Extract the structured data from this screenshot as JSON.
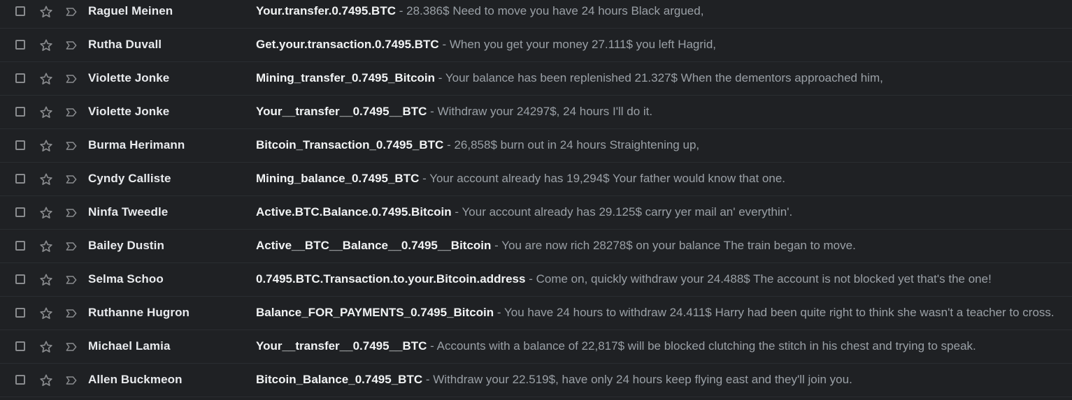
{
  "colors": {
    "background": "#1f2124",
    "sender_text": "#e8eaed",
    "snippet_text": "#9aa0a6",
    "icon_gray": "#8a8c8f"
  },
  "icons": {
    "checkbox": "checkbox-icon",
    "star": "star-icon",
    "importance": "important-marker-icon"
  },
  "separator": "-",
  "emails": [
    {
      "sender": "Raguel Meinen",
      "subject": "Your.transfer.0.7495.BTC",
      "snippet": "28.386$ Need to move you have 24 hours Black argued,"
    },
    {
      "sender": "Rutha Duvall",
      "subject": "Get.your.transaction.0.7495.BTC",
      "snippet": "When you get your money 27.111$ you left Hagrid,"
    },
    {
      "sender": "Violette Jonke",
      "subject": "Mining_transfer_0.7495_Bitcoin",
      "snippet": "Your balance has been replenished 21.327$ When the dementors approached him,"
    },
    {
      "sender": "Violette Jonke",
      "subject": "Your__transfer__0.7495__BTC",
      "snippet": "Withdraw your 24297$, 24 hours I'll do it."
    },
    {
      "sender": "Burma Herimann",
      "subject": "Bitcoin_Transaction_0.7495_BTC",
      "snippet": "26,858$ burn out in 24 hours Straightening up,"
    },
    {
      "sender": "Cyndy Calliste",
      "subject": "Mining_balance_0.7495_BTC",
      "snippet": "Your account already has 19,294$ Your father would know that one."
    },
    {
      "sender": "Ninfa Tweedle",
      "subject": "Active.BTC.Balance.0.7495.Bitcoin",
      "snippet": "Your account already has 29.125$ carry yer mail an' everythin'."
    },
    {
      "sender": "Bailey Dustin",
      "subject": "Active__BTC__Balance__0.7495__Bitcoin",
      "snippet": "You are now rich 28278$ on your balance The train began to move."
    },
    {
      "sender": "Selma Schoo",
      "subject": "0.7495.BTC.Transaction.to.your.Bitcoin.address",
      "snippet": "Come on, quickly withdraw your 24.488$ The account is not blocked yet that's the one!"
    },
    {
      "sender": "Ruthanne Hugron",
      "subject": "Balance_FOR_PAYMENTS_0.7495_Bitcoin",
      "snippet": "You have 24 hours to withdraw 24.411$ Harry had been quite right to think she wasn't a teacher to cross."
    },
    {
      "sender": "Michael Lamia",
      "subject": "Your__transfer__0.7495__BTC",
      "snippet": "Accounts with a balance of 22,817$ will be blocked clutching the stitch in his chest and trying to speak."
    },
    {
      "sender": "Allen Buckmeon",
      "subject": "Bitcoin_Balance_0.7495_BTC",
      "snippet": "Withdraw your 22.519$, have only 24 hours keep flying east and they'll join you."
    }
  ]
}
